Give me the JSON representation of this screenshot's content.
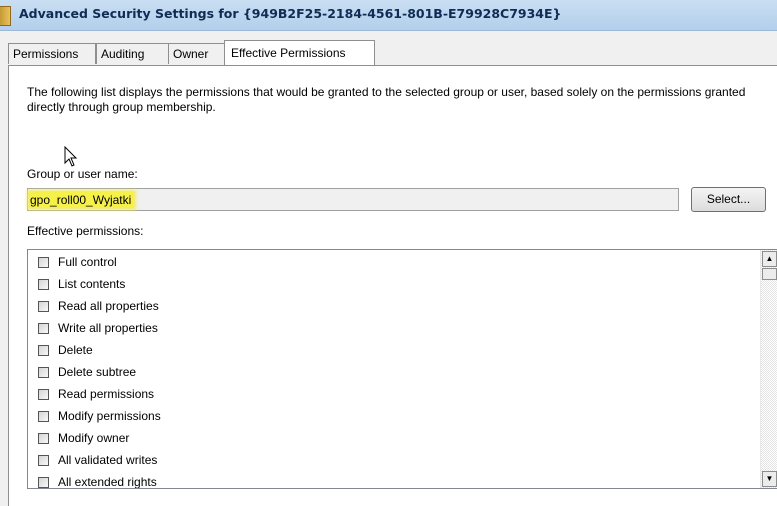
{
  "window": {
    "title": "Advanced Security Settings for {949B2F25-2184-4561-801B-E79928C7934E}"
  },
  "tabs": [
    {
      "label": "Permissions",
      "active": false
    },
    {
      "label": "Auditing",
      "active": false
    },
    {
      "label": "Owner",
      "active": false
    },
    {
      "label": "Effective Permissions",
      "active": true
    }
  ],
  "description": "The following list displays the permissions that would be granted to the selected group or user, based solely on the permissions granted directly through group membership.",
  "group_field": {
    "label": "Group or user name:",
    "value": "gpo_roll00_Wyjatki",
    "highlight_color": "#f6f04a"
  },
  "select_button": "Select...",
  "effective_permissions": {
    "label": "Effective permissions:",
    "items": [
      {
        "label": "Full control",
        "checked": false
      },
      {
        "label": "List contents",
        "checked": false
      },
      {
        "label": "Read all properties",
        "checked": false
      },
      {
        "label": "Write all properties",
        "checked": false
      },
      {
        "label": "Delete",
        "checked": false
      },
      {
        "label": "Delete subtree",
        "checked": false
      },
      {
        "label": "Read permissions",
        "checked": false
      },
      {
        "label": "Modify permissions",
        "checked": false
      },
      {
        "label": "Modify owner",
        "checked": false
      },
      {
        "label": "All validated writes",
        "checked": false
      },
      {
        "label": "All extended rights",
        "checked": false
      }
    ]
  },
  "icons": {
    "title": "folder-icon",
    "cursor": "mouse-pointer-icon",
    "scroll_up": "scroll-up-arrow-icon",
    "scroll_down": "scroll-down-arrow-icon"
  }
}
